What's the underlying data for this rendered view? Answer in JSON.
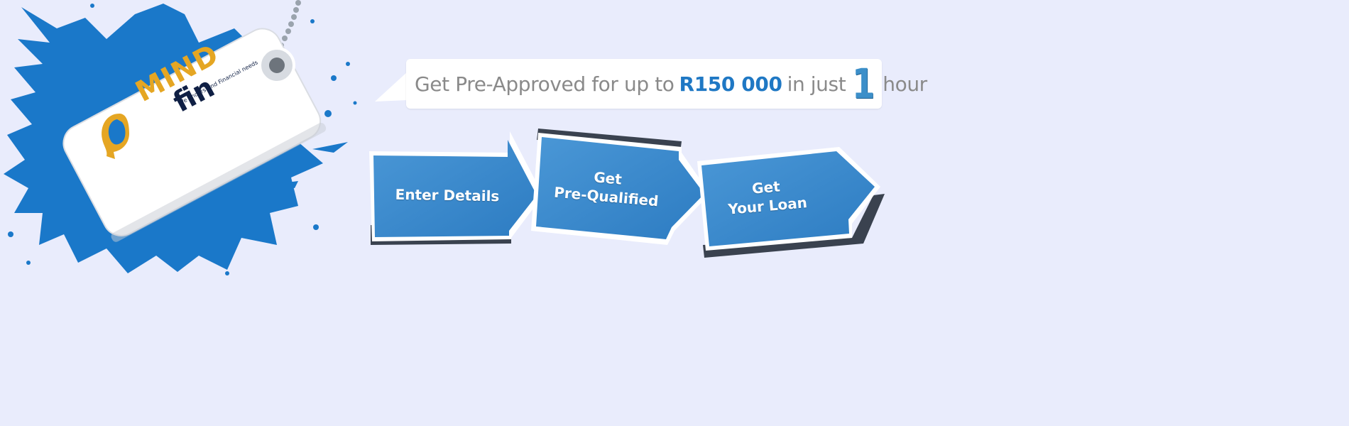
{
  "logo": {
    "mark_word_top": "MIND",
    "mark_word_bottom": "fin",
    "tagline": "We understand Financial needs",
    "colors": {
      "splash": "#1a78c9",
      "gold": "#e5a623",
      "navy": "#0f1f44"
    }
  },
  "headline": {
    "prefix": "Get Pre-Approved for up to",
    "amount": "R150 000",
    "middle": "in just",
    "number": "1",
    "suffix": "hour"
  },
  "steps": [
    {
      "label_line1": "Enter Details",
      "label_line2": ""
    },
    {
      "label_line1": "Get",
      "label_line2": "Pre-Qualified"
    },
    {
      "label_line1": "Get",
      "label_line2": "Your Loan"
    }
  ],
  "colors": {
    "background": "#e9ecfc",
    "step_blue": "#3a8bd0",
    "accent_blue": "#1f78c4",
    "text_gray": "#8a8a8a"
  }
}
